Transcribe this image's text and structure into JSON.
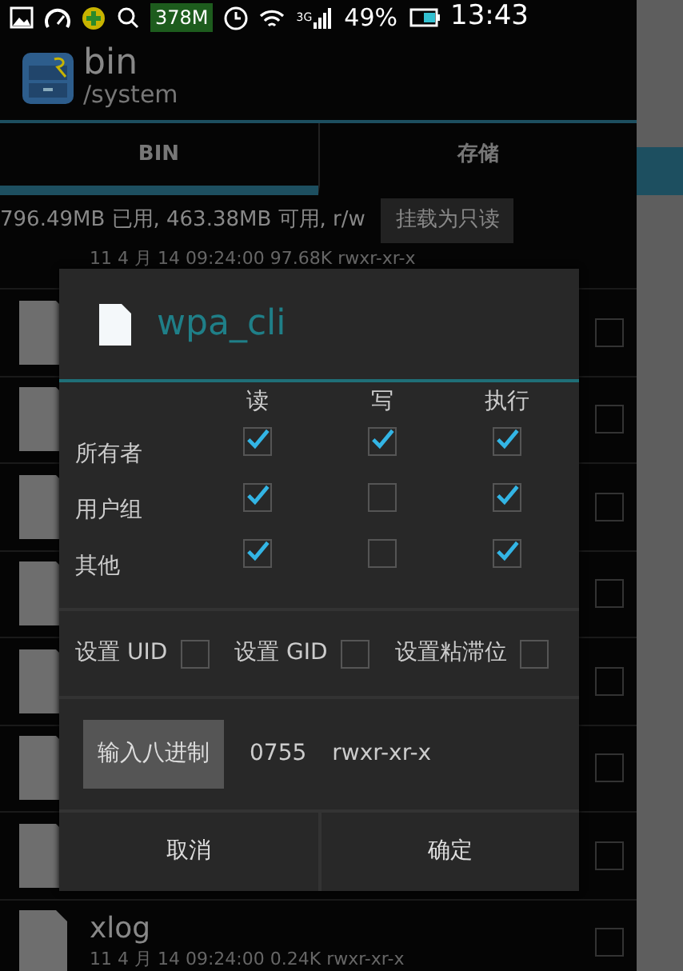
{
  "status_bar": {
    "memory": "378M",
    "network": "3G",
    "battery": "49%",
    "time": "13:43"
  },
  "app_bar": {
    "title": "bin",
    "subtitle": "/system"
  },
  "tabs": [
    {
      "label": "BIN",
      "selected": true
    },
    {
      "label": "存储",
      "selected": false
    }
  ],
  "storage": {
    "info": "796.49MB 已用, 463.38MB 可用, r/w",
    "button": "挂载为只读"
  },
  "files": [
    {
      "meta": "11 4 月 14 09:24:00  97.68K  rwxr-xr-x"
    },
    {
      "checked": false
    },
    {
      "checked": false
    },
    {
      "checked": false
    },
    {
      "checked": false
    },
    {
      "checked": false
    },
    {
      "checked": false
    },
    {
      "checked": false
    },
    {
      "name": "xlog",
      "meta": "11 4 月 14 09:24:00  0.24K  rwxr-xr-x",
      "checked": false
    }
  ],
  "dialog": {
    "title": "wpa_cli",
    "columns": [
      "读",
      "写",
      "执行"
    ],
    "rows": [
      {
        "label": "所有者",
        "checks": [
          true,
          true,
          true
        ]
      },
      {
        "label": "用户组",
        "checks": [
          true,
          false,
          true
        ]
      },
      {
        "label": "其他",
        "checks": [
          true,
          false,
          true
        ]
      }
    ],
    "special": [
      {
        "label": "设置 UID",
        "checked": false
      },
      {
        "label": "设置 GID",
        "checked": false
      },
      {
        "label": "设置粘滞位",
        "checked": false
      }
    ],
    "octal_button": "输入八进制",
    "octal": "0755",
    "symbolic": "rwxr-xr-x",
    "buttons": [
      "取消",
      "确定"
    ]
  }
}
